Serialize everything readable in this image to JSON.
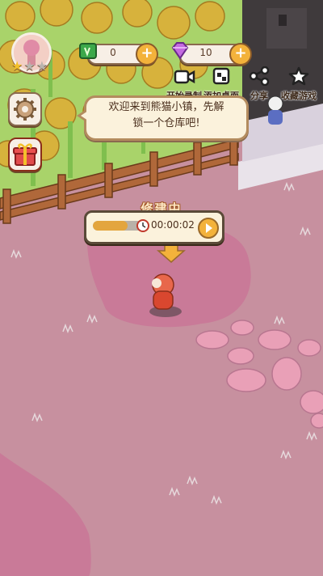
{
  "hud": {
    "coins": "0",
    "gems": "10",
    "stars_filled": 1,
    "stars_total": 3,
    "actions": [
      {
        "label": "开始录制",
        "icon": "camera-icon"
      },
      {
        "label": "添加桌面",
        "icon": "add-desktop-icon"
      },
      {
        "label": "分享",
        "icon": "share-icon"
      },
      {
        "label": "收藏游戏",
        "icon": "star-icon"
      }
    ]
  },
  "dialog": {
    "line1": "欢迎来到熊猫小镇，先解",
    "line2": "锁一个仓库吧!"
  },
  "build": {
    "title": "修建中",
    "time": "00:00:02",
    "progress": 0.7
  },
  "colors": {
    "ground": "#c98fa0",
    "plot": "#c97a98",
    "grass": "#a9d36a",
    "fence": "#b0683a",
    "accent": "#f3b23b"
  }
}
